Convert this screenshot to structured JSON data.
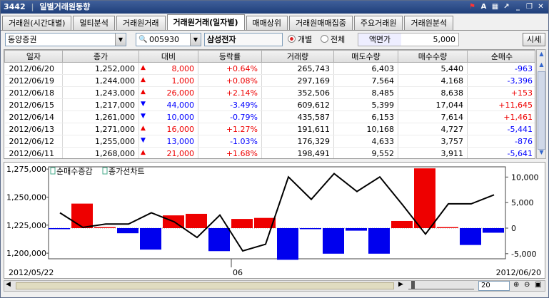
{
  "window": {
    "code": "3442",
    "title": "일별거래원동향"
  },
  "titlebar_icons": [
    "red-flag-icon",
    "font-icon",
    "export-icon",
    "link-icon",
    "minimize-icon",
    "restore-icon",
    "close-icon"
  ],
  "tabs": [
    "거래원(시간대별)",
    "멀티분석",
    "거래원거래",
    "거래원거래(일자별)",
    "매매상위",
    "거래원매매집중",
    "주요거래원",
    "거래원분석"
  ],
  "active_tab": 3,
  "filters": {
    "broker": "동양증권",
    "code": "005930",
    "stock_name": "삼성전자",
    "radio_individual": "개별",
    "radio_all": "전체",
    "face_label": "액면가",
    "face_value": "5,000",
    "market_button": "시세"
  },
  "table": {
    "headers": [
      "일자",
      "종가",
      "대비",
      "등락률",
      "거래량",
      "매도수량",
      "매수수량",
      "순매수"
    ],
    "rows": [
      {
        "date": "2012/06/20",
        "close": "1,252,000",
        "dir": "up",
        "change": "8,000",
        "rate": "+0.64%",
        "volume": "265,743",
        "sell": "6,403",
        "buy": "5,440",
        "net": "-963"
      },
      {
        "date": "2012/06/19",
        "close": "1,244,000",
        "dir": "up",
        "change": "1,000",
        "rate": "+0.08%",
        "volume": "297,169",
        "sell": "7,564",
        "buy": "4,168",
        "net": "-3,396"
      },
      {
        "date": "2012/06/18",
        "close": "1,243,000",
        "dir": "up",
        "change": "26,000",
        "rate": "+2.14%",
        "volume": "352,506",
        "sell": "8,485",
        "buy": "8,638",
        "net": "+153"
      },
      {
        "date": "2012/06/15",
        "close": "1,217,000",
        "dir": "dn",
        "change": "44,000",
        "rate": "-3.49%",
        "volume": "609,612",
        "sell": "5,399",
        "buy": "17,044",
        "net": "+11,645"
      },
      {
        "date": "2012/06/14",
        "close": "1,261,000",
        "dir": "dn",
        "change": "10,000",
        "rate": "-0.79%",
        "volume": "435,587",
        "sell": "6,153",
        "buy": "7,614",
        "net": "+1,461"
      },
      {
        "date": "2012/06/13",
        "close": "1,271,000",
        "dir": "up",
        "change": "16,000",
        "rate": "+1.27%",
        "volume": "191,611",
        "sell": "10,168",
        "buy": "4,727",
        "net": "-5,441"
      },
      {
        "date": "2012/06/12",
        "close": "1,255,000",
        "dir": "dn",
        "change": "13,000",
        "rate": "-1.03%",
        "volume": "176,329",
        "sell": "4,633",
        "buy": "3,757",
        "net": "-876"
      },
      {
        "date": "2012/06/11",
        "close": "1,268,000",
        "dir": "up",
        "change": "21,000",
        "rate": "+1.68%",
        "volume": "198,491",
        "sell": "9,552",
        "buy": "3,911",
        "net": "-5,641"
      }
    ]
  },
  "chart_data": {
    "type": "bar",
    "legend": [
      "순매수증감",
      "종가선차트"
    ],
    "left_axis_ticks": [
      "1,275,000",
      "1,250,000",
      "1,225,000",
      "1,200,000"
    ],
    "right_axis_ticks": [
      "10,000",
      "5,000",
      "0",
      "-5,000"
    ],
    "ylim_left": [
      1195000,
      1277000
    ],
    "ylim_right": [
      -6000,
      12000
    ],
    "bars": [
      -200,
      4800,
      200,
      -1000,
      -4200,
      2500,
      2800,
      -4500,
      1800,
      2000,
      -6200,
      -200,
      -5000,
      -500,
      -5000,
      1400,
      11700,
      200,
      -3300,
      -900
    ],
    "close": [
      1236000,
      1223000,
      1226000,
      1226000,
      1236000,
      1228000,
      1214000,
      1234000,
      1202000,
      1208000,
      1268000,
      1248000,
      1271000,
      1255000,
      1268000,
      1243000,
      1217000,
      1244000,
      1244000,
      1252000
    ],
    "colors": {
      "up": "#ee0000",
      "down": "#0000ee",
      "line": "#000000"
    },
    "x_start": "2012/05/22",
    "x_mid": "06",
    "x_end": "2012/06/20"
  },
  "zoom": {
    "value": "20"
  }
}
